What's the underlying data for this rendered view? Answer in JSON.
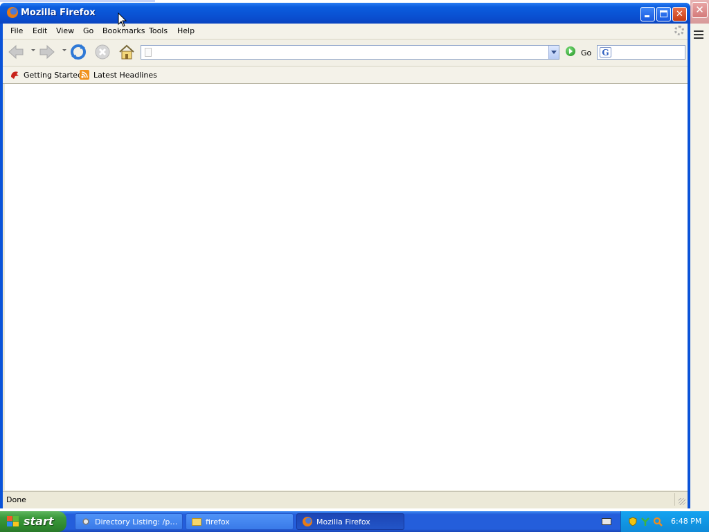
{
  "window": {
    "title": "Mozilla Firefox",
    "controls": {
      "minimize": "Minimize",
      "maximize": "Maximize",
      "close": "Close"
    }
  },
  "menubar": {
    "items": [
      "File",
      "Edit",
      "View",
      "Go",
      "Bookmarks",
      "Tools",
      "Help"
    ]
  },
  "navbar": {
    "back_icon": "back-arrow-icon",
    "forward_icon": "forward-arrow-icon",
    "reload_icon": "reload-icon",
    "stop_icon": "stop-icon",
    "home_icon": "home-icon",
    "url": {
      "value": "",
      "placeholder": ""
    },
    "go_label": "Go",
    "search": {
      "value": "",
      "engine_icon": "google-icon",
      "engine_letter": "G"
    }
  },
  "bookmarks": {
    "items": [
      {
        "label": "Getting Started",
        "icon": "firefox-bookmark-icon"
      },
      {
        "label": "Latest Headlines",
        "icon": "rss-feed-icon"
      }
    ]
  },
  "status": {
    "text": "Done"
  },
  "taskbar": {
    "start_label": "start",
    "tasks": [
      {
        "label": "Directory Listing: /pu...",
        "icon": "browser-icon",
        "active": false
      },
      {
        "label": "firefox",
        "icon": "folder-icon",
        "active": false
      },
      {
        "label": "Mozilla Firefox",
        "icon": "firefox-icon",
        "active": true
      }
    ],
    "clock": "6:48 PM"
  },
  "colors": {
    "titlebar": "#0a53d8",
    "taskbar": "#245edb",
    "start": "#3c9a3c",
    "tray": "#0f8ad8",
    "chrome": "#ece9d8"
  }
}
